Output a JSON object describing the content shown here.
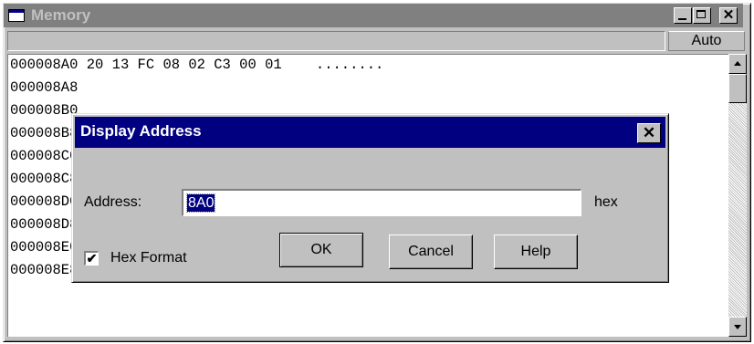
{
  "window": {
    "title": "Memory",
    "icon": "window-icon",
    "buttons": {
      "minimize": "_",
      "maximize": "□",
      "close": "✕"
    }
  },
  "toolbar": {
    "address_value": "",
    "auto_label": "Auto"
  },
  "memory": {
    "rows": [
      {
        "address": "000008A0",
        "bytes": "20 13 FC 08 02 C3 00 01",
        "ascii": "........"
      },
      {
        "address": "000008A8",
        "bytes": "",
        "ascii": ""
      },
      {
        "address": "000008B0",
        "bytes": "",
        "ascii": ""
      },
      {
        "address": "000008B8",
        "bytes": "",
        "ascii": ""
      },
      {
        "address": "000008C0",
        "bytes": "",
        "ascii": ""
      },
      {
        "address": "000008C8",
        "bytes": "",
        "ascii": ""
      },
      {
        "address": "000008D0",
        "bytes": "",
        "ascii": ""
      },
      {
        "address": "000008D8",
        "bytes": "",
        "ascii": ""
      },
      {
        "address": "000008E0",
        "bytes": "-- -- -- -- -- -- -- --",
        "ascii": "--------"
      },
      {
        "address": "000008E8",
        "bytes": "-- -- -- -- -- -- -- --",
        "ascii": "--------"
      }
    ]
  },
  "dialog": {
    "title": "Display Address",
    "close": "✕",
    "address_label": "Address:",
    "address_value": "8A0",
    "hex_suffix": "hex",
    "hex_format_label": "Hex Format",
    "hex_format_checked": true,
    "check_mark": "✔",
    "ok_label": "OK",
    "cancel_label": "Cancel",
    "help_label": "Help"
  }
}
